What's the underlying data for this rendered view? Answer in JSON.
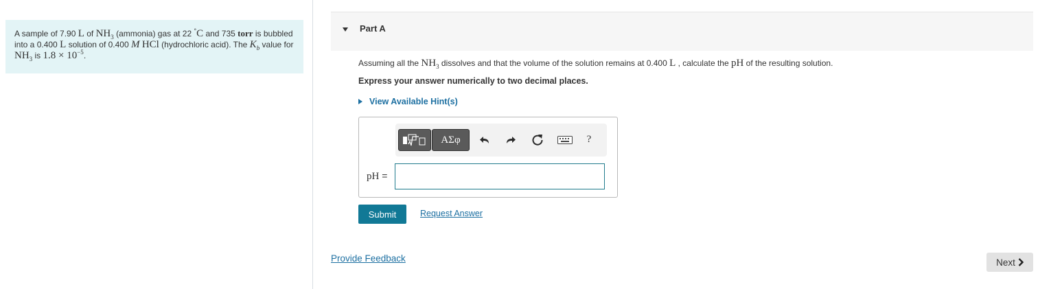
{
  "problem": {
    "t1": "A sample of 7.90 ",
    "u1": "L",
    "t2": " of ",
    "nh3_base": "NH",
    "nh3_sub": "3",
    "t3": " (ammonia) gas at 22 ",
    "deg": "°",
    "u2": "C",
    "t4": " and 735 ",
    "u3": "torr",
    "t5": " is bubbled into a 0.400 ",
    "u4": "L",
    "t6": " solution of 0.400 ",
    "u5": "M",
    "u6": "HCl",
    "t7": " (hydrochloric acid). The ",
    "kb_base": "K",
    "kb_sub": "b",
    "t8": " value for ",
    "nh3b_base": "NH",
    "nh3b_sub": "3",
    "t9": " is ",
    "val": "1.8 × 10",
    "val_exp": "−5",
    "t10": "."
  },
  "part": {
    "title": "Part A"
  },
  "question": {
    "q1": "Assuming all the ",
    "q_nh3": "NH",
    "q_nh3_sub": "3",
    "q2": " dissolves and that the volume of the solution remains at 0.400 ",
    "q_l": "L",
    "q3": " , calculate the ",
    "q_ph": "pH",
    "q4": " of the resulting solution."
  },
  "instruction": "Express your answer numerically to two decimal places.",
  "hint_label": "View Available Hint(s)",
  "toolbar": {
    "greek_label": "ΑΣφ",
    "help_label": "?",
    "icons": [
      "templates-icon",
      "undo-icon",
      "redo-icon",
      "reset-icon",
      "keyboard-icon",
      "help-icon"
    ]
  },
  "answer": {
    "label": "pH",
    "equals": " =",
    "value": ""
  },
  "actions": {
    "submit": "Submit",
    "request_answer": "Request Answer"
  },
  "feedback_link": "Provide Feedback",
  "next_label": "Next",
  "colors": {
    "panel_bg": "#e3f4f6",
    "link": "#1c6fa1",
    "submit_bg": "#117996",
    "input_border": "#1f7a8c",
    "toolbar_bg": "#f2f2f2"
  }
}
